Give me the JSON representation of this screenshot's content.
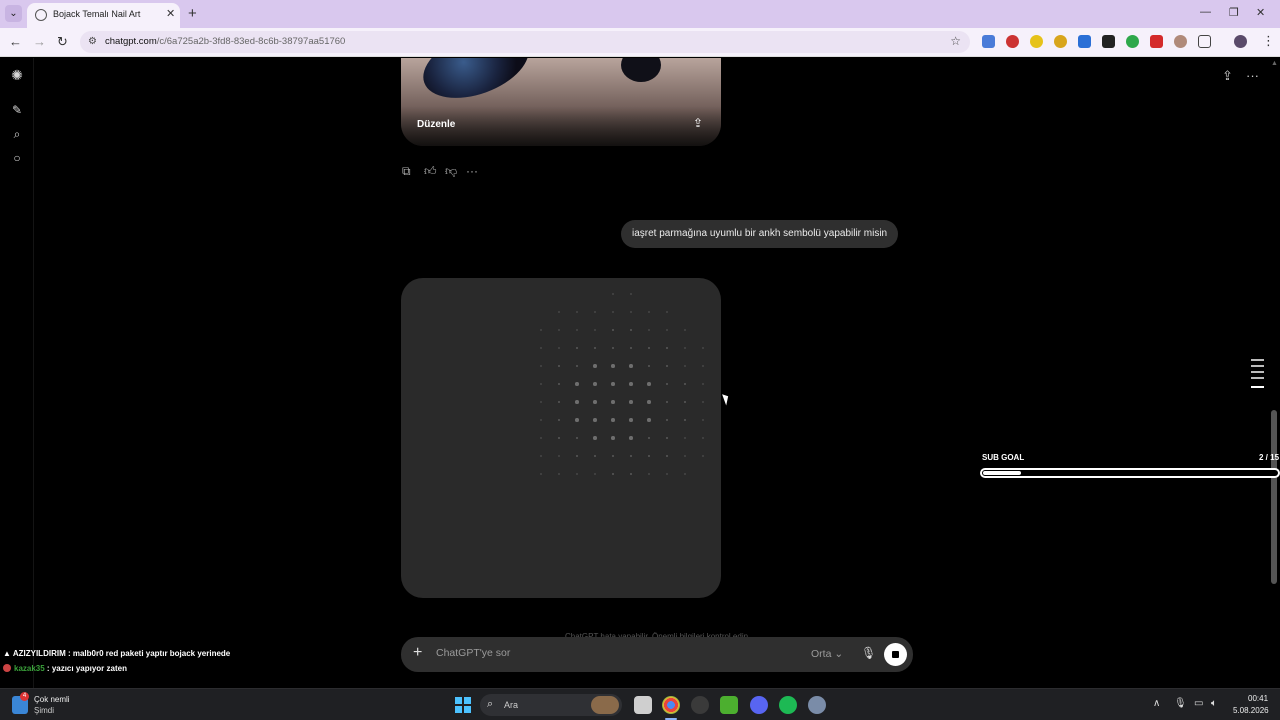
{
  "browser": {
    "tab_title": "Bojack Temalı Nail Art",
    "tab_close": "✕",
    "new_tab": "+",
    "url_host": "chatgpt.com",
    "url_path": "/c/6a725a2b-3fd8-83ed-8c6b-38797aa51760",
    "window_controls": [
      "—",
      "❐",
      "✕"
    ]
  },
  "chat": {
    "prev_image_edit_label": "Düzenle",
    "user_message": "iaşret parmağına uyumlu bir ankh sembolü yapabilir misin",
    "disclaimer": "ChatGPT hata yapabilir. Önemli bilgileri kontrol edin.",
    "composer": {
      "placeholder": "ChatGPT'ye sor",
      "model_label": "Orta"
    }
  },
  "overlay": {
    "subgoal_title": "SUB GOAL",
    "subgoal_count": "2 / 15",
    "subgoal_progress": 0.13,
    "chat_lines": [
      {
        "user": "AZIZYILDIRIM",
        "text": " : malb0r0 red paketi yaptır bojack yerinede"
      },
      {
        "user": "kazak35",
        "text": " : yazıcı yapıyor zaten"
      }
    ]
  },
  "taskbar": {
    "notification_title": "Çok nemli",
    "notification_sub": "Şimdi",
    "notification_badge": "4",
    "search_label": "Ara",
    "time": "00:41",
    "date": "5.08.2026"
  },
  "icons": {
    "colors": {
      "accent": "#4cc2ff",
      "tabbar": "#d9c8ee",
      "bubble": "#2f2f2f",
      "gen_card": "#2a2a2a"
    }
  }
}
